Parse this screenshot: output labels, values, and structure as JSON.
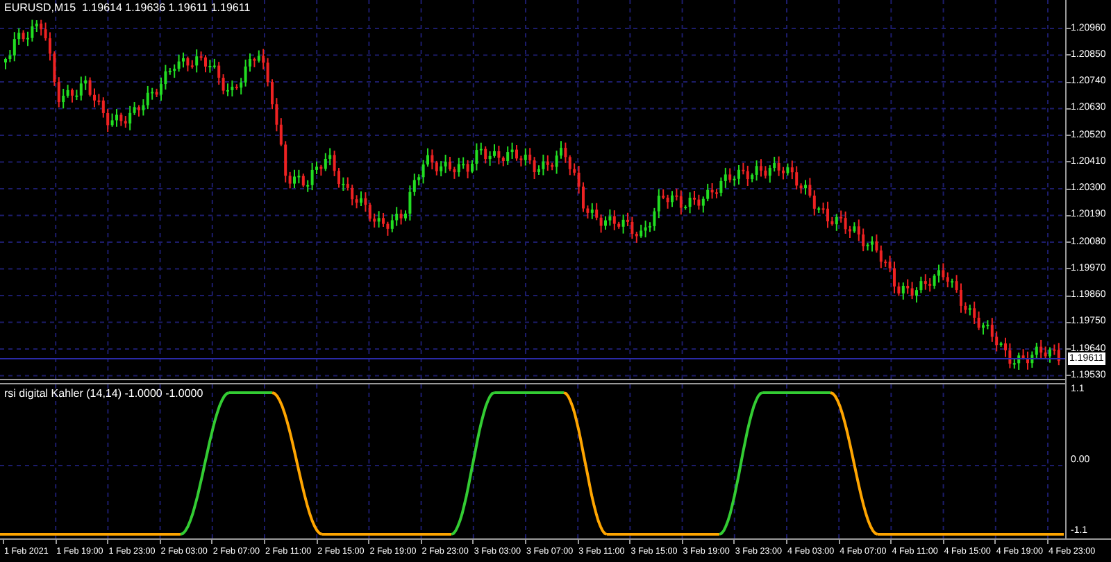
{
  "chart_header": "EURUSD,M15  1.19614 1.19636 1.19611 1.19611",
  "price_axis": [
    "1.20960",
    "1.20850",
    "1.20740",
    "1.20630",
    "1.20520",
    "1.20410",
    "1.20300",
    "1.20190",
    "1.20080",
    "1.19970",
    "1.19860",
    "1.19750",
    "1.19640",
    "1.19530"
  ],
  "current_price": "1.19611",
  "indicator": {
    "header": "rsi digital Kahler (14,14) -1.0000 -1.0000",
    "axis": [
      "1.1",
      "0.00",
      "-1.1"
    ]
  },
  "time_axis": [
    "1 Feb 2021",
    "1 Feb 19:00",
    "1 Feb 23:00",
    "2 Feb 03:00",
    "2 Feb 07:00",
    "2 Feb 11:00",
    "2 Feb 15:00",
    "2 Feb 19:00",
    "2 Feb 23:00",
    "3 Feb 03:00",
    "3 Feb 07:00",
    "3 Feb 11:00",
    "3 Feb 15:00",
    "3 Feb 19:00",
    "3 Feb 23:00",
    "4 Feb 03:00",
    "4 Feb 07:00",
    "4 Feb 11:00",
    "4 Feb 15:00",
    "4 Feb 19:00",
    "4 Feb 23:00"
  ]
}
